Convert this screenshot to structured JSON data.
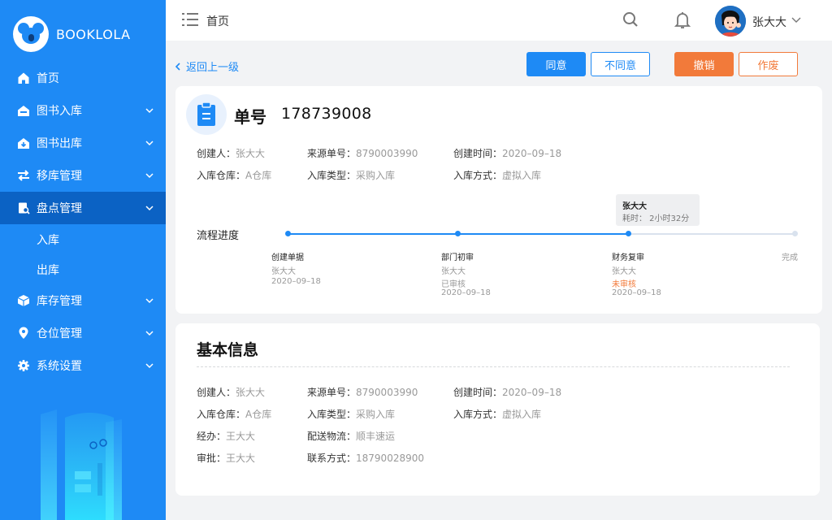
{
  "brand": {
    "name": "BOOKLOLA",
    "accent": "#1e8af5",
    "active_bg": "#0b62c4",
    "warn": "#f27a3a"
  },
  "sidebar": {
    "items": [
      {
        "label": "首页",
        "icon": "home-icon"
      },
      {
        "label": "图书入库",
        "icon": "book-in-icon"
      },
      {
        "label": "图书出库",
        "icon": "book-out-icon"
      },
      {
        "label": "移库管理",
        "icon": "transfer-icon"
      },
      {
        "label": "盘点管理",
        "icon": "inventory-check-icon"
      },
      {
        "label": "库存管理",
        "icon": "box-icon"
      },
      {
        "label": "仓位管理",
        "icon": "location-pin-icon"
      },
      {
        "label": "系统设置",
        "icon": "gear-icon"
      }
    ],
    "subitems": [
      {
        "label": "入库"
      },
      {
        "label": "出库"
      }
    ]
  },
  "header": {
    "breadcrumb": "首页",
    "user_name": "张大大"
  },
  "actions": {
    "back": "返回上一级",
    "agree": "同意",
    "disagree": "不同意",
    "revoke": "撤销",
    "void": "作废"
  },
  "order": {
    "label": "单号",
    "number": "178739008",
    "fields": [
      {
        "k": "创建人：",
        "v": "张大大"
      },
      {
        "k": "来源单号：",
        "v": "8790003990"
      },
      {
        "k": "创建时间：",
        "v": "2020–09–18"
      },
      {
        "k": "入库仓库：",
        "v": "A仓库"
      },
      {
        "k": "入库类型：",
        "v": "采购入库"
      },
      {
        "k": "入库方式：",
        "v": "虚拟入库"
      }
    ]
  },
  "flow": {
    "label": "流程进度",
    "tooltip": {
      "name": "张大大",
      "duration": "耗时： 2小时32分"
    },
    "steps": [
      {
        "title": "创建单据",
        "person": "张大大",
        "status": "",
        "date": "2020–09–18"
      },
      {
        "title": "部门初审",
        "person": "张大大",
        "status": "已审核",
        "date": "2020–09–18"
      },
      {
        "title": "财务复审",
        "person": "张大大",
        "status": "未审核",
        "date": "2020–09–18"
      },
      {
        "title": "完成",
        "person": "",
        "status": "",
        "date": ""
      }
    ]
  },
  "basic": {
    "title": "基本信息",
    "fields": [
      {
        "k": "创建人：",
        "v": "张大大"
      },
      {
        "k": "来源单号：",
        "v": "8790003990"
      },
      {
        "k": "创建时间：",
        "v": "2020–09–18"
      },
      {
        "k": "入库仓库：",
        "v": "A仓库"
      },
      {
        "k": "入库类型：",
        "v": "采购入库"
      },
      {
        "k": "入库方式：",
        "v": "虚拟入库"
      },
      {
        "k": "经办：",
        "v": "王大大"
      },
      {
        "k": "配送物流：",
        "v": "顺丰速运"
      },
      {
        "k": "审批：",
        "v": "王大大"
      },
      {
        "k": "联系方式：",
        "v": "18790028900"
      }
    ]
  }
}
